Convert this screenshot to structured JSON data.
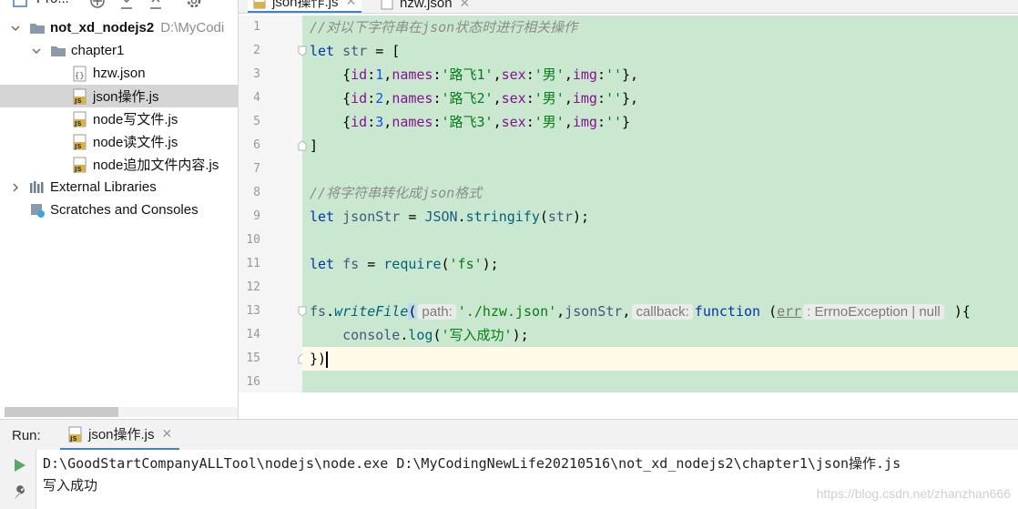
{
  "project_panel": {
    "title": "Pro...",
    "tree": [
      {
        "label": "not_xd_nodejs2",
        "hint": "D:\\MyCodi",
        "type": "folder",
        "expanded": true
      },
      {
        "label": "chapter1",
        "type": "folder",
        "expanded": true
      },
      {
        "label": "hzw.json",
        "type": "json"
      },
      {
        "label": "json操作.js",
        "type": "js",
        "selected": true
      },
      {
        "label": "node写文件.js",
        "type": "js"
      },
      {
        "label": "node读文件.js",
        "type": "js"
      },
      {
        "label": "node追加文件内容.js",
        "type": "js"
      },
      {
        "label": "External Libraries",
        "type": "libraries",
        "expanded": false
      },
      {
        "label": "Scratches and Consoles",
        "type": "scratches"
      }
    ]
  },
  "editor": {
    "tabs": [
      {
        "label": "json操作.js",
        "active": true
      },
      {
        "label": "hzw.json",
        "active": false
      }
    ],
    "current_line": 15,
    "line_numbers": [
      "1",
      "2",
      "3",
      "4",
      "5",
      "6",
      "7",
      "8",
      "9",
      "10",
      "11",
      "12",
      "13",
      "14",
      "15",
      "16"
    ],
    "code": {
      "l1": "//对以下字符串在json状态时进行相关操作",
      "l2_kw": "let",
      "l2_var": "str",
      "l2_rest": " = [",
      "l3": {
        "open": "    {",
        "k1": "id",
        "v1": "1",
        "k2": "names",
        "v2": "'路飞1'",
        "k3": "sex",
        "v3": "'男'",
        "k4": "img",
        "v4": "''",
        "close": "},"
      },
      "l4": {
        "open": "    {",
        "k1": "id",
        "v1": "2",
        "k2": "names",
        "v2": "'路飞2'",
        "k3": "sex",
        "v3": "'男'",
        "k4": "img",
        "v4": "''",
        "close": "},"
      },
      "l5": {
        "open": "    {",
        "k1": "id",
        "v1": "3",
        "k2": "names",
        "v2": "'路飞3'",
        "k3": "sex",
        "v3": "'男'",
        "k4": "img",
        "v4": "''",
        "close": "}"
      },
      "l6": "]",
      "l8": "//将字符串转化成json格式",
      "l9": {
        "kw": "let",
        "var": "jsonStr",
        "eq": " = ",
        "obj": "JSON",
        "dot": ".",
        "method": "stringify",
        "arg": "str",
        "end": ");"
      },
      "l11": {
        "kw": "let",
        "var": "fs",
        "eq": " = ",
        "fn": "require",
        "str": "'fs'",
        "end": ");"
      },
      "l13": {
        "obj": "fs",
        "dot": ".",
        "method": "writeFile",
        "paren": "(",
        "hint_path": "path:",
        "str": "'./hzw.json'",
        "comma": ",",
        "arg": "jsonStr",
        "comma2": ",",
        "hint_cb": "callback:",
        "kw": "function",
        "pparen": " (",
        "param": "err",
        "type_hint": ": ErrnoException | null",
        "end": " ){"
      },
      "l14": {
        "obj": "    console",
        "dot": ".",
        "method": "log",
        "str": "'写入成功'",
        "end": ");"
      },
      "l15": "})"
    }
  },
  "run": {
    "label": "Run:",
    "tab_label": "json操作.js",
    "console_lines": [
      "D:\\GoodStartCompanyALLTool\\nodejs\\node.exe D:\\MyCodingNewLife20210516\\not_xd_nodejs2\\chapter1\\json操作.js",
      "写入成功"
    ]
  },
  "watermark": "https://blog.csdn.net/zhanzhan666"
}
